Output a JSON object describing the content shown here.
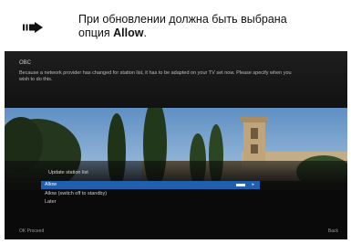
{
  "instruction": {
    "line1": "При обновлении должна быть выбрана",
    "line2_prefix": "опция ",
    "line2_bold": "Allow",
    "line2_suffix": "."
  },
  "icons": {
    "instruction_marker": "arrow-right-icon"
  },
  "tv_header": {
    "title": "OBC",
    "message": "Because a network provider has changed for station list, it has to be adapted on your TV set now. Please specify when you wish to do this."
  },
  "panel": {
    "title": "Update station list",
    "options": [
      {
        "label": "Allow",
        "selected": true
      },
      {
        "label": "Allow (switch off to standby)",
        "selected": false
      },
      {
        "label": "Later",
        "selected": false
      }
    ]
  },
  "footer": {
    "left": "OK Proceed",
    "right": "Back"
  },
  "colors": {
    "selection": "#1f5fae",
    "screen_bg": "#0c0c0c"
  }
}
